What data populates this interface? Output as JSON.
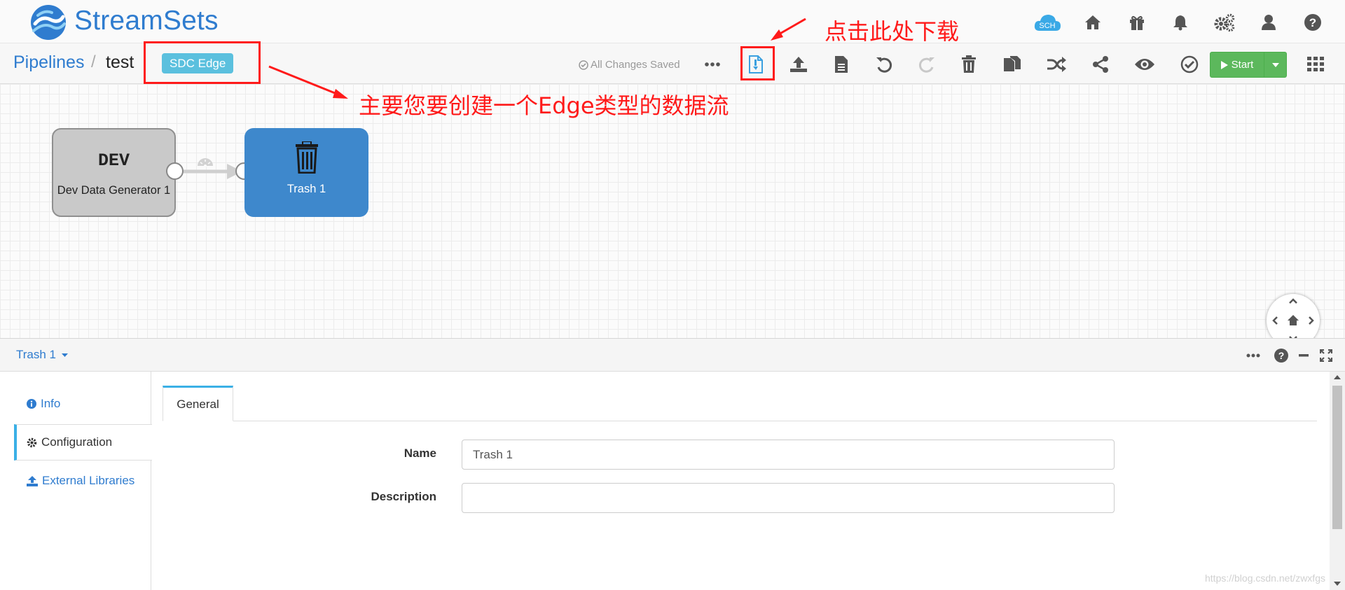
{
  "header": {
    "brand": "StreamSets",
    "sch_label": "SCH",
    "icons": [
      "sch-cloud-icon",
      "home-icon",
      "gift-icon",
      "bell-icon",
      "gears-icon",
      "user-icon",
      "help-icon"
    ]
  },
  "toolbar": {
    "breadcrumb_root": "Pipelines",
    "breadcrumb_sep": "/",
    "pipeline_name": "test",
    "execution_badge": "SDC Edge",
    "save_status": "All Changes Saved",
    "start_label": "Start",
    "icons": [
      "more-icon",
      "download-edge-icon",
      "publish-icon",
      "document-icon",
      "undo-icon",
      "redo-icon",
      "delete-icon",
      "duplicate-icon",
      "shuffle-icon",
      "share-icon",
      "preview-icon",
      "validate-icon",
      "apps-grid-icon"
    ]
  },
  "canvas": {
    "nodes": [
      {
        "code": "DEV",
        "label": "Dev Data Generator 1",
        "color": "#c9c9c9"
      },
      {
        "label": "Trash 1",
        "color": "#3e88cc"
      }
    ]
  },
  "detail": {
    "title": "Trash 1",
    "side_tabs": [
      {
        "label": "Info",
        "icon": "info-icon"
      },
      {
        "label": "Configuration",
        "icon": "cog-icon",
        "active": true
      },
      {
        "label": "External Libraries",
        "icon": "upload-icon"
      }
    ],
    "config_tab": "General",
    "fields": [
      {
        "label": "Name",
        "value": "Trash 1"
      },
      {
        "label": "Description",
        "value": ""
      }
    ]
  },
  "annotations": {
    "download_hint": "点击此处下载",
    "edge_hint": "主要您要创建一个Edge类型的数据流",
    "color": "#ff1a1a"
  },
  "watermark": "https://blog.csdn.net/zwxfgs"
}
